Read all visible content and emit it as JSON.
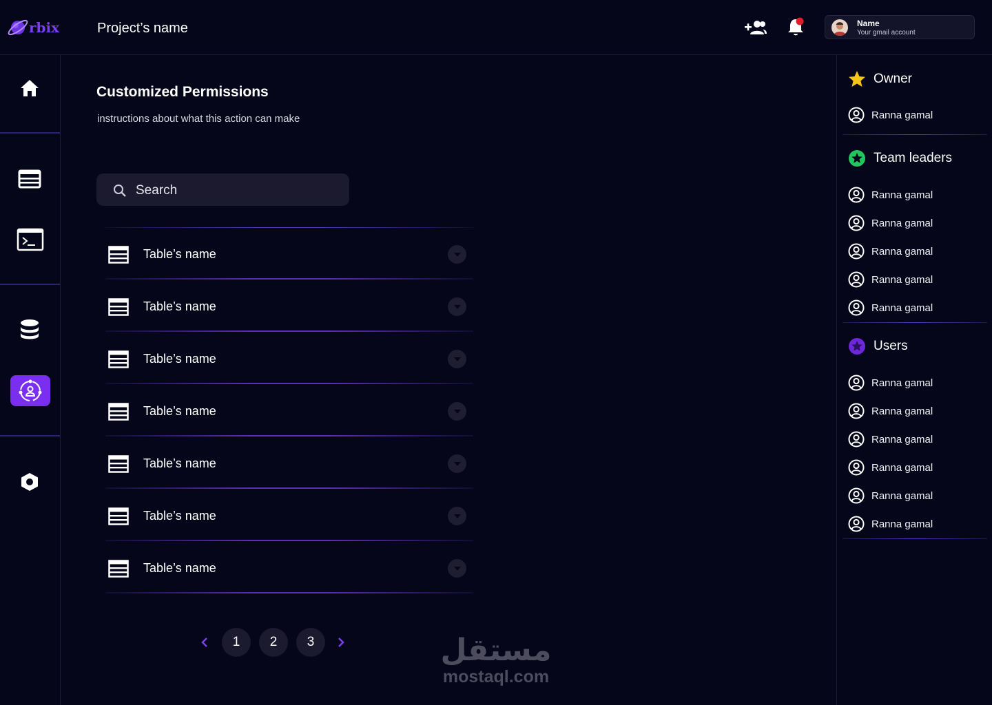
{
  "brand": {
    "logo_text": "rbix",
    "accent": "#7a2ff0"
  },
  "header": {
    "project_name": "Project’s name"
  },
  "account": {
    "name": "Name",
    "email": "Your gmail account"
  },
  "main": {
    "title": "Customized Permissions",
    "subtitle": "instructions about what this action can make",
    "search_placeholder": "Search",
    "tables": [
      {
        "label": "Table’s name"
      },
      {
        "label": "Table’s name"
      },
      {
        "label": "Table’s name"
      },
      {
        "label": "Table’s name"
      },
      {
        "label": "Table’s name"
      },
      {
        "label": "Table’s name"
      },
      {
        "label": "Table’s name"
      }
    ],
    "pagination": {
      "pages": [
        "1",
        "2",
        "3"
      ]
    }
  },
  "watermark": {
    "arabic": "مستقل",
    "latin": "mostaql.com"
  },
  "roles": {
    "owner": {
      "title": "Owner",
      "icon": "star-icon",
      "color": "#f5c518",
      "members": [
        "Ranna gamal"
      ]
    },
    "team_leaders": {
      "title": "Team leaders",
      "icon": "green-star-badge-icon",
      "color": "#22c55e",
      "members": [
        "Ranna gamal",
        "Ranna gamal",
        "Ranna gamal",
        "Ranna gamal",
        "Ranna gamal"
      ]
    },
    "users": {
      "title": "Users",
      "icon": "purple-star-badge-icon",
      "color": "#6d28d9",
      "members": [
        "Ranna gamal",
        "Ranna gamal",
        "Ranna gamal",
        "Ranna gamal",
        "Ranna gamal",
        "Ranna gamal"
      ]
    }
  },
  "colors": {
    "background": "#06061a",
    "notification_dot": "#e11d2a"
  }
}
